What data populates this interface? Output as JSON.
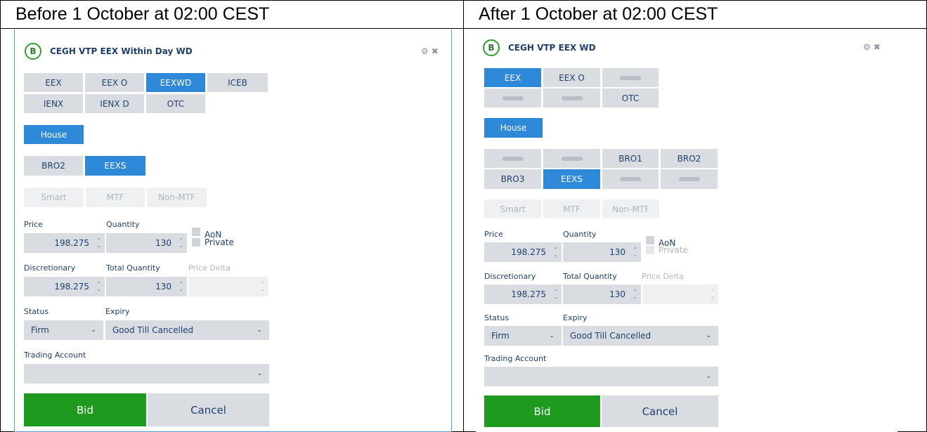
{
  "headers": {
    "before": "Before 1 October at 02:00 CEST",
    "after": "After 1 October at 02:00 CEST"
  },
  "left": {
    "badge": "B",
    "title": "CEGH VTP EEX Within Day WD",
    "tools": "⚙ ✖",
    "markets": [
      "EEX",
      "EEX O",
      "EEXWD",
      "ICEB",
      "IENX",
      "IENX D",
      "OTC"
    ],
    "house": "House",
    "brokers": [
      "BRO2",
      "EEXS"
    ],
    "venues": [
      "Smart",
      "MTF",
      "Non-MTF"
    ],
    "price_label": "Price",
    "price": "198.275",
    "quantity_label": "Quantity",
    "quantity": "130",
    "aon": "AoN",
    "private": "Private",
    "disc_label": "Discretionary",
    "disc": "198.275",
    "total_label": "Total Quantity",
    "total": "130",
    "delta_label": "Price Delta",
    "status_label": "Status",
    "status": "Firm",
    "expiry_label": "Expiry",
    "expiry": "Good Till Cancelled",
    "account_label": "Trading Account",
    "bid": "Bid",
    "cancel": "Cancel"
  },
  "right": {
    "badge": "B",
    "title": "CEGH VTP EEX WD",
    "tools": "⚙ ✖",
    "markets": [
      "EEX",
      "EEX O",
      "",
      "",
      "",
      "OTC"
    ],
    "house": "House",
    "brokers": [
      "",
      "",
      "BRO1",
      "BRO2",
      "BRO3",
      "EEXS",
      "",
      ""
    ],
    "venues": [
      "Smart",
      "MTF",
      "Non-MTF"
    ],
    "price_label": "Price",
    "price": "198.275",
    "quantity_label": "Quantity",
    "quantity": "130",
    "aon": "AoN",
    "private": "Private",
    "disc_label": "Discretionary",
    "disc": "198.275",
    "total_label": "Total Quantity",
    "total": "130",
    "delta_label": "Price Delta",
    "status_label": "Status",
    "status": "Firm",
    "expiry_label": "Expiry",
    "expiry": "Good Till Cancelled",
    "account_label": "Trading Account",
    "bid": "Bid",
    "cancel": "Cancel"
  }
}
